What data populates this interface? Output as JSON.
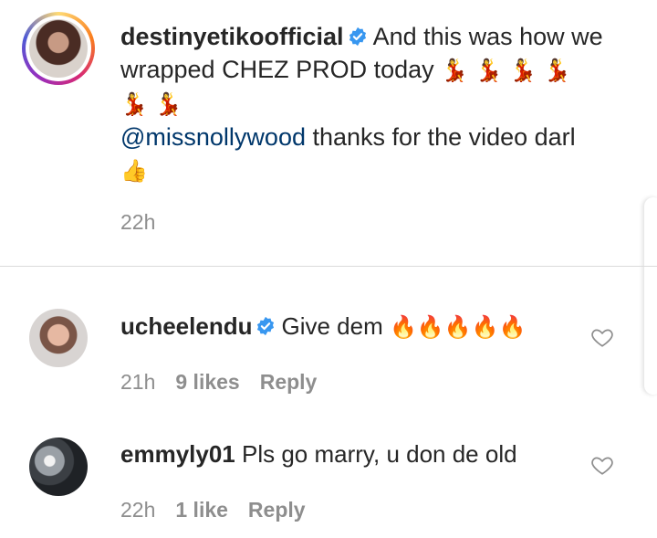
{
  "caption": {
    "username": "destinyetikoofficial",
    "text": "And this was how we wrapped CHEZ PROD today",
    "emoji_line1": "💃 💃 💃 💃",
    "emoji_line2": "💃 💃",
    "mention": "@missnollywood",
    "mention_text": "thanks for the video darl",
    "emoji_line3": "👍",
    "time": "22h"
  },
  "comments": [
    {
      "username": "ucheelendu",
      "text": "Give dem",
      "emoji": "🔥🔥🔥🔥🔥",
      "time": "21h",
      "likes": "9 likes",
      "reply": "Reply"
    },
    {
      "username": "emmyly01",
      "text": "Pls go marry, u don de old",
      "time": "22h",
      "likes": "1 like",
      "reply": "Reply"
    }
  ],
  "colors": {
    "verified": "#3897f0",
    "mention": "#00376b",
    "muted": "#8e8e8e"
  }
}
